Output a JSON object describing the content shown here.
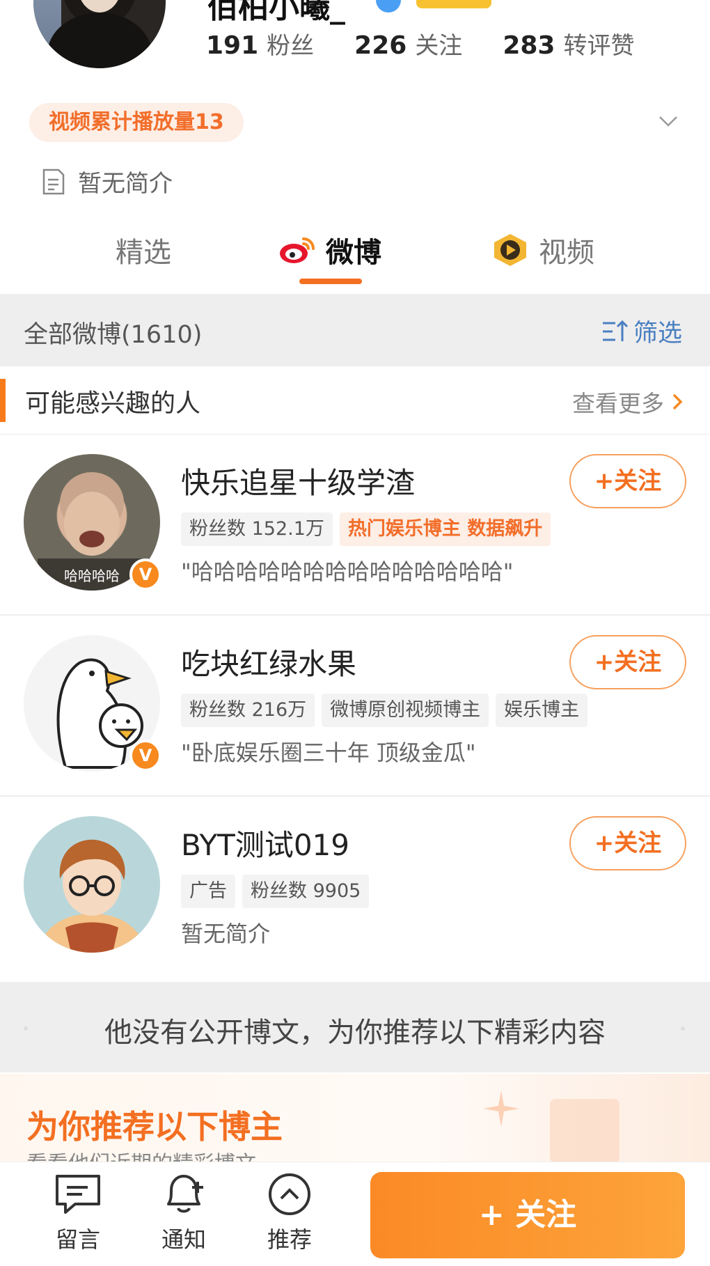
{
  "profile": {
    "username": "佰柏小曦_",
    "stats": [
      {
        "value": "191",
        "label": "粉丝"
      },
      {
        "value": "226",
        "label": "关注"
      },
      {
        "value": "283",
        "label": "转评赞"
      }
    ],
    "play_badge": "视频累计播放量13",
    "bio": "暂无简介"
  },
  "tabs": [
    {
      "label": "精选",
      "active": false
    },
    {
      "label": "微博",
      "active": true,
      "icon": "weibo-icon"
    },
    {
      "label": "视频",
      "active": false,
      "icon": "video-icon"
    }
  ],
  "filter_bar": {
    "title": "全部微博(1610)",
    "filter_label": "筛选"
  },
  "suggestions": {
    "title": "可能感兴趣的人",
    "see_more": "查看更多",
    "people": [
      {
        "name": "快乐追星十级学渣",
        "tags": [
          "粉丝数 152.1万",
          "热门娱乐博主 数据飙升"
        ],
        "desc": "\"哈哈哈哈哈哈哈哈哈哈哈哈哈哈\"",
        "follow": "+关注",
        "avatar_caption": "哈哈哈哈"
      },
      {
        "name": "吃块红绿水果",
        "tags": [
          "粉丝数 216万",
          "微博原创视频博主",
          "娱乐博主"
        ],
        "desc": "\"卧底娱乐圈三十年 顶级金瓜\"",
        "follow": "+关注"
      },
      {
        "name": "BYT测试019",
        "tags": [
          "广告",
          "粉丝数 9905"
        ],
        "desc": "暂无简介",
        "follow": "+关注"
      }
    ],
    "badge_symbol": "V"
  },
  "notice": "他没有公开博文，为你推荐以下精彩内容",
  "recommend": {
    "title": "为你推荐以下博主",
    "subtitle": "看看他们近期的精彩博文"
  },
  "bottom_bar": {
    "items": [
      {
        "label": "留言",
        "icon": "message-icon"
      },
      {
        "label": "通知",
        "icon": "bell-plus-icon"
      },
      {
        "label": "推荐",
        "icon": "chevron-up-circle-icon"
      }
    ],
    "follow_label": "+ 关注"
  },
  "colors": {
    "accent": "#f36f21",
    "link": "#4a7fc1",
    "tag_hot_bg": "#fdeee6"
  }
}
